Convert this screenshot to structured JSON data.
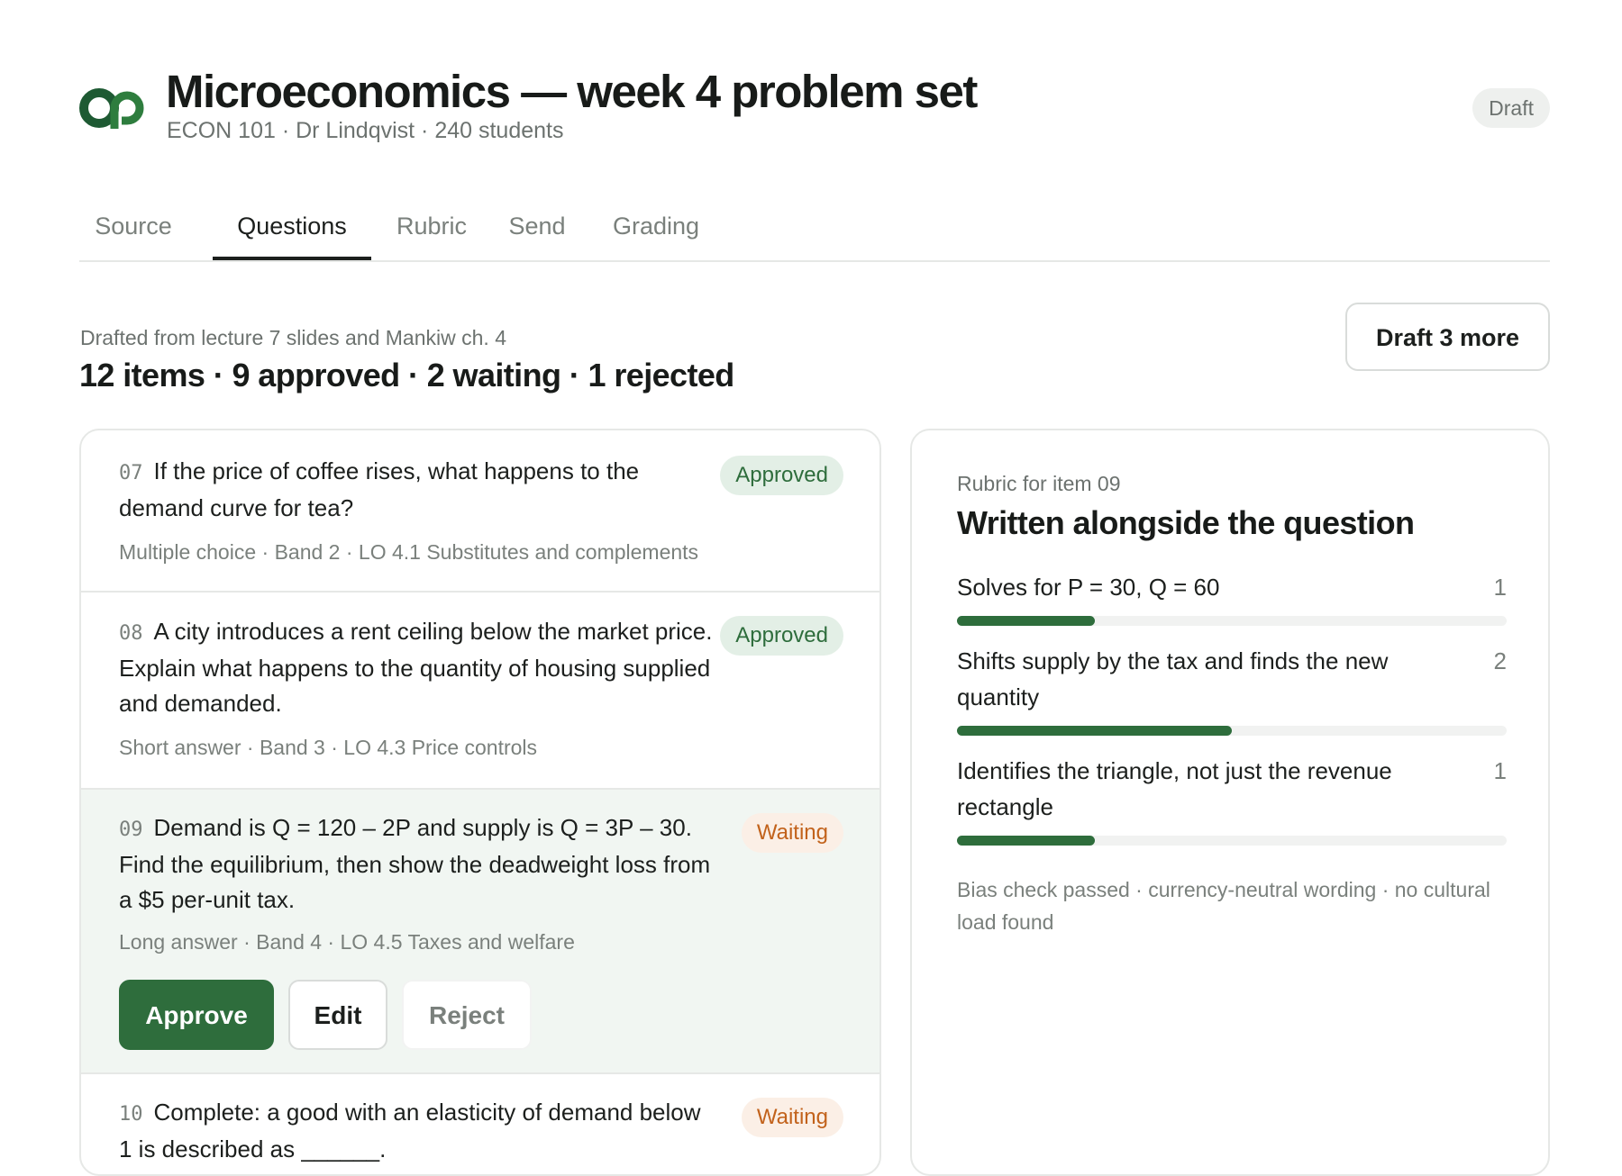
{
  "header": {
    "title": "Microeconomics — week 4 problem set",
    "subtitle": "ECON 101 · Dr Lindqvist · 240 students",
    "status_badge": "Draft",
    "logo_icon": "ap-logo-icon",
    "logo_color": "#1e5a33"
  },
  "tabs": [
    {
      "label": "Source",
      "active": false
    },
    {
      "label": "Questions",
      "active": true
    },
    {
      "label": "Rubric",
      "active": false
    },
    {
      "label": "Send",
      "active": false
    },
    {
      "label": "Grading",
      "active": false
    }
  ],
  "toolbar": {
    "drafted_from": "Drafted from lecture 7 slides and Mankiw ch. 4",
    "summary": "12 items · 9 approved · 2 waiting · 1 rejected",
    "draft_more_label": "Draft 3 more"
  },
  "questions": [
    {
      "num": "07",
      "text": "If the price of coffee rises, what happens to the demand curve for tea?",
      "meta": "Multiple choice · Band 2 · LO 4.1 Substitutes and complements",
      "status": "Approved"
    },
    {
      "num": "08",
      "text": "A city introduces a rent ceiling below the market price. Explain what happens to the quantity of housing supplied and demanded.",
      "meta": "Short answer · Band 3 · LO 4.3 Price controls",
      "status": "Approved"
    },
    {
      "num": "09",
      "text": "Demand is Q = 120 – 2P and supply is Q = 3P – 30. Find the equilibrium, then show the deadweight loss from a $5 per-unit tax.",
      "meta": "Long answer · Band 4 · LO 4.5 Taxes and welfare",
      "status": "Waiting",
      "actions": {
        "approve": "Approve",
        "edit": "Edit",
        "reject": "Reject"
      }
    },
    {
      "num": "10",
      "text": "Complete: a good with an elasticity of demand below 1 is described as ______.",
      "status": "Waiting"
    }
  ],
  "rubric": {
    "eyebrow": "Rubric for item 09",
    "title": "Written alongside the question",
    "criteria": [
      {
        "label": "Solves for P = 30, Q = 60",
        "points": "1",
        "fill_fraction": 0.25
      },
      {
        "label": "Shifts supply by the tax and finds the new quantity",
        "points": "2",
        "fill_fraction": 0.5
      },
      {
        "label": "Identifies the triangle, not just the revenue rectangle",
        "points": "1",
        "fill_fraction": 0.25
      }
    ],
    "bias_note": "Bias check passed · currency-neutral wording · no cultural load found"
  },
  "colors": {
    "accent_green": "#2e6d3c",
    "approved_bg": "#e3efe6",
    "waiting_text": "#c2621b",
    "waiting_bg": "#fbefe6",
    "selected_row_bg": "#f1f6f2"
  }
}
